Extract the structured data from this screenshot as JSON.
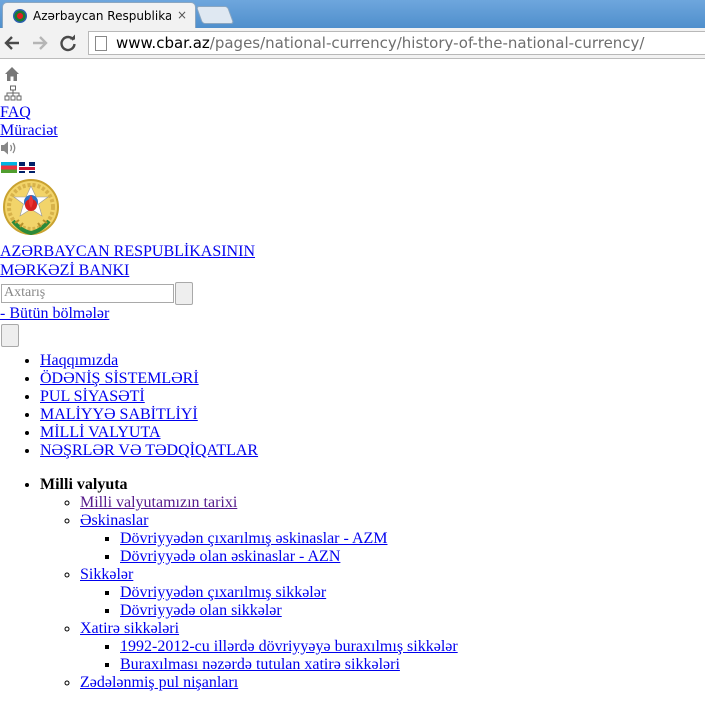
{
  "browser": {
    "tab_title": "Azərbaycan Respublikasın",
    "close_glyph": "×",
    "url_host": "www.cbar.az",
    "url_path": "/pages/national-currency/history-of-the-national-currency/"
  },
  "top_links": {
    "faq": "FAQ",
    "contact": "Müraciət"
  },
  "bank_name": {
    "line1": "AZƏRBAYCAN RESPUBLİKASININ",
    "line2": "MƏRKƏZİ BANKI"
  },
  "search": {
    "placeholder": "Axtarış",
    "scope": "- Bütün bölmələr"
  },
  "main_nav": [
    "Haqqımızda",
    "ÖDƏNİŞ SİSTEMLƏRİ",
    "PUL SİYASƏTİ",
    "MALİYYƏ SABİTLİYİ",
    "MİLLİ VALYUTA",
    "NƏŞRLƏR VƏ TƏDQİQATLAR"
  ],
  "section": {
    "title": "Milli valyuta",
    "items": {
      "history": "Milli valyutamızın tarixi",
      "banknotes": "Əskinaslar",
      "banknotes_withdrawn": "Dövriyyədən çıxarılmış əskinaslar - AZM",
      "banknotes_current": "Dövriyyədə olan əskinaslar - AZN",
      "coins": "Sikkələr",
      "coins_withdrawn": "Dövriyyədən çıxarılmış sikkələr",
      "coins_current": "Dövriyyədə olan sikkələr",
      "commemorative": "Xatirə sikkələri",
      "commemorative_1992_2012": "1992-2012-cu illərdə dövriyyəyə buraxılmış sikkələr",
      "commemorative_planned": "Buraxılması nəzərdə tutulan xatirə sikkələri",
      "damaged": "Zədələnmiş pul nişanları"
    }
  }
}
